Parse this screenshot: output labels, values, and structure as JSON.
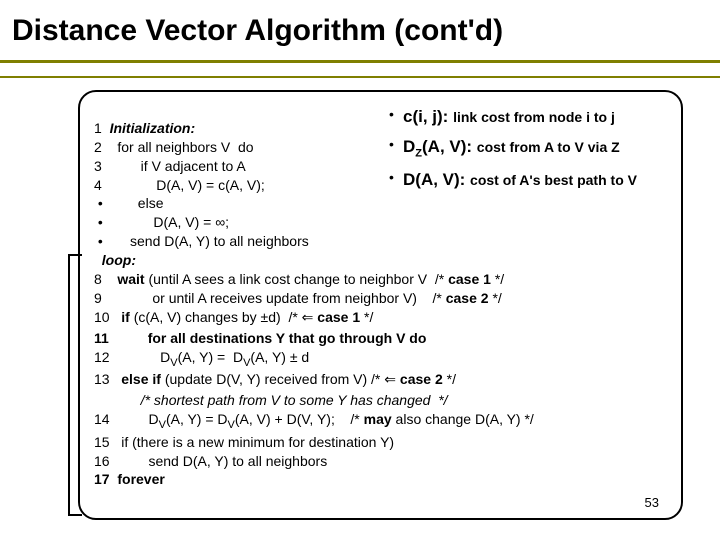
{
  "title": "Distance Vector Algorithm (cont'd)",
  "pseudo": {
    "l1": "1  Initialization:",
    "l2": "2    for all neighbors V  do",
    "l3": "3          if V adjacent to A",
    "l4": "4              D(A, V) = c(A, V);",
    "l5": " •         else",
    "l6": " •             D(A, V) = ∞;",
    "l7": " •       send D(A, Y) to all neighbors",
    "l8": "  loop:",
    "l9": "8    wait (until A sees a link cost change to neighbor V  /* case 1 */",
    "l10": "9             or until A receives update from neighbor V)    /* case 2 */",
    "l11": "10   if (c(A, V) changes by ±d)  /* ⇐ case 1 */",
    "l12": "11          for all destinations Y that go through V do",
    "l13_pre": "12             D",
    "l13_sub": "V",
    "l13_mid": "(A, Y) =  D",
    "l13_sub2": "V",
    "l13_post": "(A, Y) ± d",
    "l14": "13   else if (update D(V, Y) received from V) /* ⇐ case 2 */",
    "l15": "            /* shortest path from V to some Y has changed  */",
    "l16_pre": "14          D",
    "l16_sub": "V",
    "l16_mid": "(A, Y) = D",
    "l16_sub2": "V",
    "l16_post": "(A, V) + D(V, Y);    /* may also change D(A, Y) */",
    "l17": "15   if (there is a new minimum for destination Y)",
    "l18": "16          send D(A, Y) to all neighbors",
    "l19": "17  forever"
  },
  "notes": {
    "n1_fn": "c(i, j): ",
    "n1_txt": "link cost from node i to j",
    "n2_fn_a": "D",
    "n2_fn_sub": "Z",
    "n2_fn_b": "(A, V): ",
    "n2_txt": "cost from A to V via Z",
    "n3_fn": "D(A, V): ",
    "n3_txt": "cost of A's best path to V"
  },
  "page": "53",
  "chart_data": {
    "type": "table",
    "title": "Distance Vector Algorithm pseudocode with notation definitions",
    "notation": [
      {
        "symbol": "c(i, j)",
        "meaning": "link cost from node i to j"
      },
      {
        "symbol": "D_Z(A, V)",
        "meaning": "cost from A to V via Z"
      },
      {
        "symbol": "D(A, V)",
        "meaning": "cost of A's best path to V"
      }
    ],
    "pseudocode_lines": [
      "1  Initialization:",
      "2    for all neighbors V do",
      "3      if V adjacent to A",
      "4        D(A, V) = c(A, V);",
      "       else",
      "         D(A, V) = ∞;",
      "     send D(A, Y) to all neighbors",
      "   loop:",
      "8    wait (until A sees a link cost change to neighbor V  /* case 1 */",
      "9          or until A receives update from neighbor V)    /* case 2 */",
      "10   if (c(A, V) changes by ±d)  /* ⇐ case 1 */",
      "11     for all destinations Y that go through V do",
      "12       D_V(A, Y) = D_V(A, Y) ± d",
      "13   else if (update D(V, Y) received from V) /* ⇐ case 2 */",
      "       /* shortest path from V to some Y has changed */",
      "14     D_V(A, Y) = D_V(A, V) + D(V, Y);  /* may also change D(A, Y) */",
      "15   if (there is a new minimum for destination Y)",
      "16     send D(A, Y) to all neighbors",
      "17 forever"
    ]
  }
}
